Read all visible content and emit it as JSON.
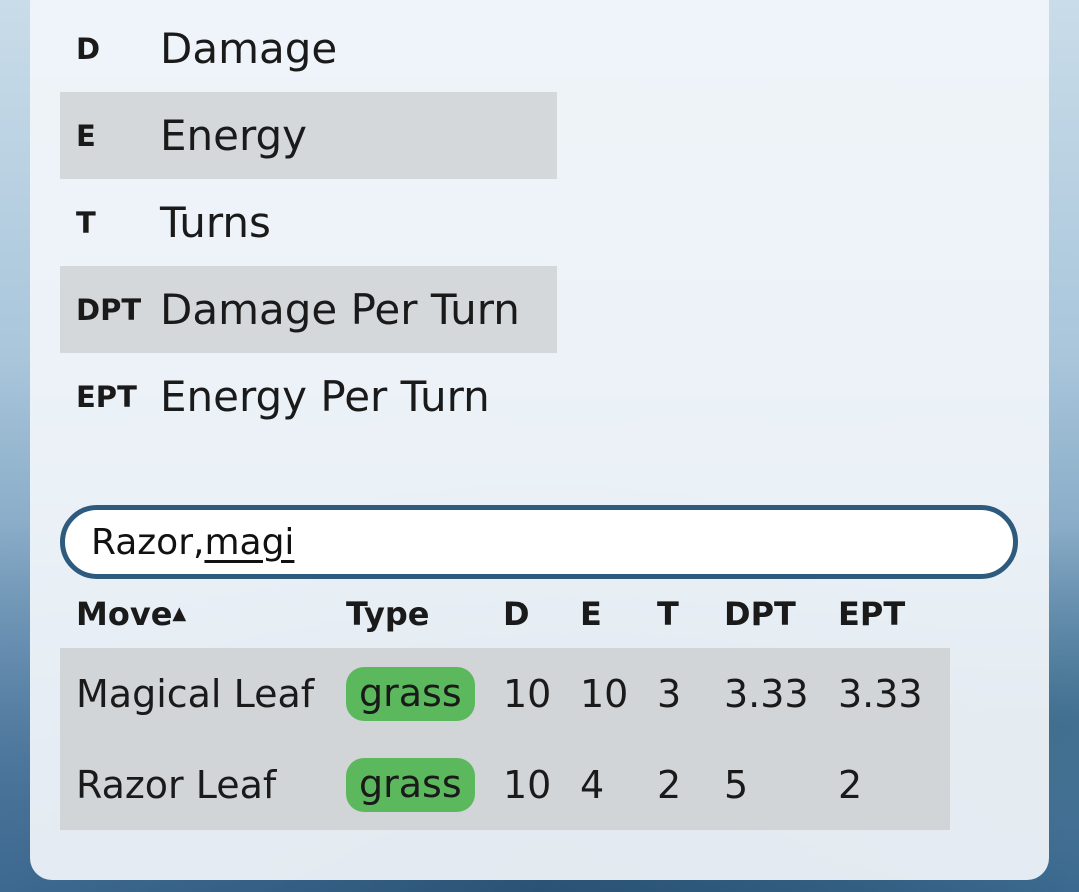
{
  "legend": [
    {
      "abbr": "D",
      "label": "Damage"
    },
    {
      "abbr": "E",
      "label": "Energy"
    },
    {
      "abbr": "T",
      "label": "Turns"
    },
    {
      "abbr": "DPT",
      "label": "Damage Per Turn"
    },
    {
      "abbr": "EPT",
      "label": "Energy Per Turn"
    }
  ],
  "search": {
    "value_plain": "Razor,",
    "value_underlined": "magi"
  },
  "table": {
    "headers": {
      "move": "Move",
      "sort_indicator": "▲",
      "type": "Type",
      "d": "D",
      "e": "E",
      "t": "T",
      "dpt": "DPT",
      "ept": "EPT"
    },
    "rows": [
      {
        "move": "Magical Leaf",
        "type": "grass",
        "d": "10",
        "e": "10",
        "t": "3",
        "dpt": "3.33",
        "ept": "3.33"
      },
      {
        "move": "Razor Leaf",
        "type": "grass",
        "d": "10",
        "e": "4",
        "t": "2",
        "dpt": "5",
        "ept": "2"
      }
    ]
  },
  "colors": {
    "grass_badge": "#5cb85c",
    "search_border": "#2e5a7d",
    "shaded_row": "#d5d8db"
  }
}
